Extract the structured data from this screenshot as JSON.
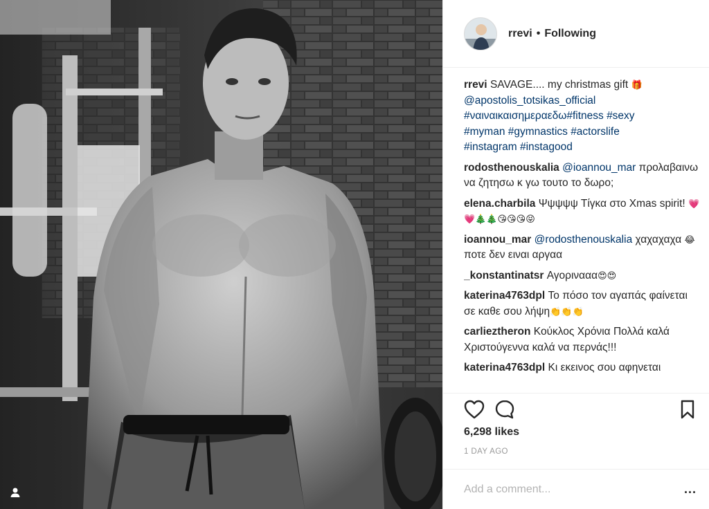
{
  "post": {
    "username": "rrevi",
    "follow_separator": "•",
    "follow_status": "Following",
    "likes": "6,298 likes",
    "time_ago": "1 DAY AGO",
    "comment_placeholder": "Add a comment...",
    "more_label": "..."
  },
  "caption": {
    "user": "rrevi",
    "text": "SAVAGE.... my christmas gift",
    "emoji": "🎁",
    "mention": "@apostolis_totsikas_official",
    "hashtags_line1": "#ναιναικαισημεραεδω#fitness #sexy",
    "hashtags_line2": "#myman #gymnastics #actorslife",
    "hashtags_line3": "#instagram #instagood"
  },
  "comments": [
    {
      "user": "rodosthenouskalia",
      "mention": "@ioannou_mar",
      "text": "προλαβαινω να ζητησω κ γω τουτο το δωρο;"
    },
    {
      "user": "elena.charbila",
      "text": "Ψψψψψ Τίγκα στο Χmas spirit!",
      "emoji": "💗💗🎄🎄😘😘😘😝"
    },
    {
      "user": "ioannou_mar",
      "mention": "@rodosthenouskalia",
      "text": "χαχαχαχα",
      "emoji": "😂",
      "text2": "ποτε δεν ειναι αργαα"
    },
    {
      "user": "_konstantinatsr",
      "text": "Αγορινααα",
      "emoji": "😍😍"
    },
    {
      "user": "katerina4763dpl",
      "text": "Το πόσο τον αγαπάς φαίνεται σε καθε σου λήψη",
      "emoji": "👏👏👏"
    },
    {
      "user": "carlieztheron",
      "text": "Κούκλος Χρόνια Πολλά καλά Χριστούγεννα καλά να περνάς!!!"
    },
    {
      "user": "katerina4763dpl",
      "text": "Κι εκεινος σου αφηνεται"
    }
  ],
  "icons": {
    "heart": "heart-icon",
    "comment": "comment-bubble-icon",
    "bookmark": "bookmark-icon",
    "tag": "user-tag-icon"
  },
  "colors": {
    "link": "#003569",
    "text": "#262626",
    "muted": "#999999",
    "border": "#efefef"
  }
}
